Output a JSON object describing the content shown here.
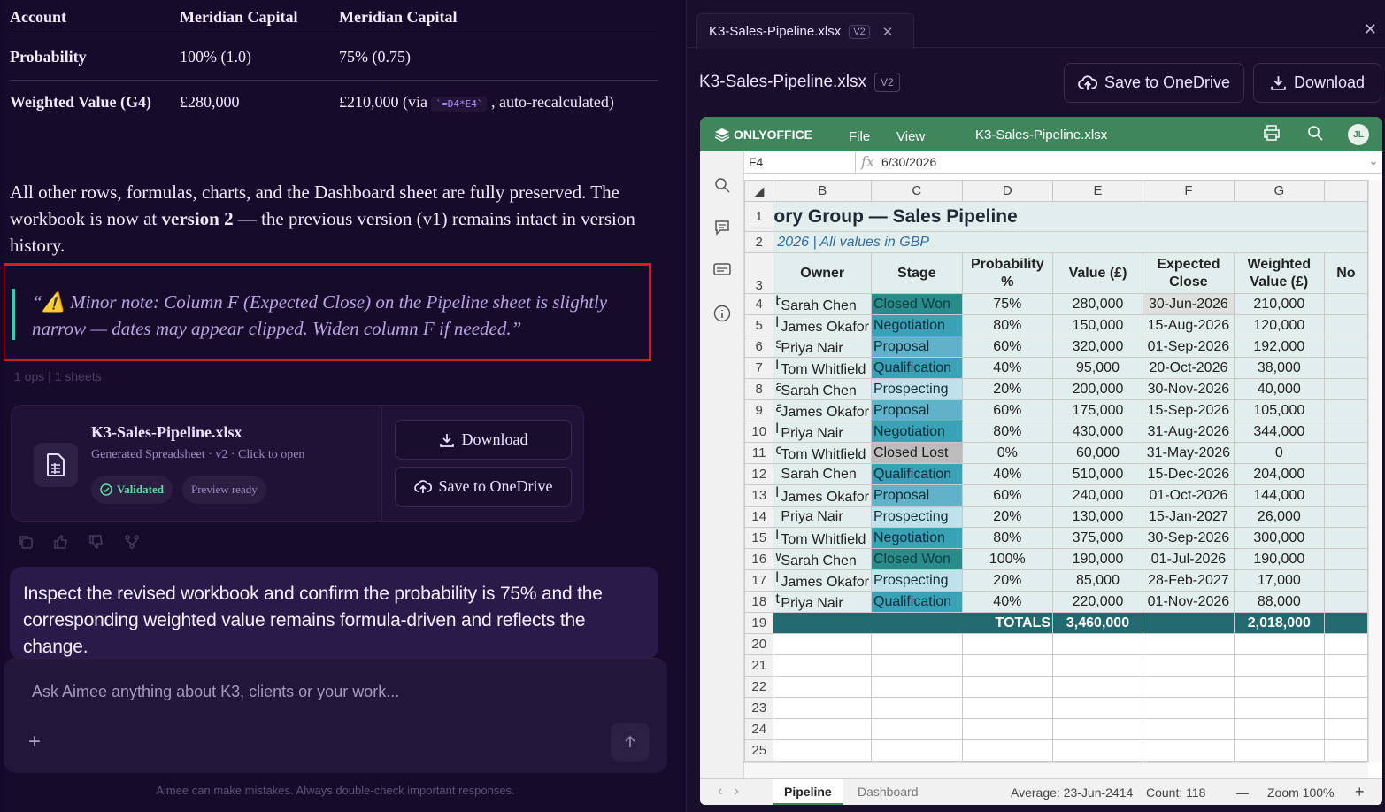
{
  "summary_table": {
    "headers": [
      "Account",
      "Meridian Capital",
      "Meridian Capital"
    ],
    "rows": [
      [
        "Probability",
        "100% (1.0)",
        "75% (0.75)"
      ],
      [
        "Weighted Value (G4)",
        "£280,000",
        "£210,000 (via",
        "`=D4*E4`",
        ", auto-recalculated)"
      ]
    ]
  },
  "paragraph": {
    "before": "All other rows, formulas, charts, and the Dashboard sheet are fully preserved. The workbook is now at ",
    "bold": "version 2",
    "after": " — the previous version (v1) remains intact in version history."
  },
  "note": "“⚠️ Minor note: Column F (Expected Close) on the Pipeline sheet is slightly narrow — dates may appear clipped. Widen column F if needed.”",
  "faint_label": "1 ops | 1 sheets",
  "file_card": {
    "name": "K3-Sales-Pipeline.xlsx",
    "subtitle": "Generated Spreadsheet · v2 · Click to open",
    "validated": "Validated",
    "preview": "Preview ready",
    "download": "Download",
    "onedrive": "Save to OneDrive"
  },
  "user_message": "Inspect the revised workbook and confirm the probability is 75% and the corresponding weighted value remains formula-driven and reflects the change.",
  "input": {
    "placeholder": "Ask Aimee anything about K3, clients or your work..."
  },
  "disclaimer": "Aimee can make mistakes. Always double-check important responses.",
  "panel": {
    "tab_name": "K3-Sales-Pipeline.xlsx",
    "version": "V2",
    "title": "K3-Sales-Pipeline.xlsx",
    "onedrive": "Save to OneDrive",
    "download": "Download"
  },
  "onlyoffice": {
    "logo": "ONLYOFFICE",
    "menu": [
      "File",
      "View"
    ],
    "doc_title": "K3-Sales-Pipeline.xlsx",
    "avatar": "JL",
    "cell_ref": "F4",
    "formula": "6/30/2026",
    "columns": [
      "B",
      "C",
      "D",
      "E",
      "F",
      "G"
    ],
    "title_text": "ory Group — Sales Pipeline",
    "subtitle_text": "2026  |  All values in GBP",
    "headers": [
      "Owner",
      "Stage",
      "Probability %",
      "Value (£)",
      "Expected Close",
      "Weighted Value (£)",
      "No"
    ],
    "rows": [
      [
        "Sarah Chen",
        "Closed Won",
        "75%",
        "280,000",
        "30-Jun-2026",
        "210,000"
      ],
      [
        "James Okafor",
        "Negotiation",
        "80%",
        "150,000",
        "15-Aug-2026",
        "120,000"
      ],
      [
        "Priya Nair",
        "Proposal",
        "60%",
        "320,000",
        "01-Sep-2026",
        "192,000"
      ],
      [
        "Tom Whitfield",
        "Qualification",
        "40%",
        "95,000",
        "20-Oct-2026",
        "38,000"
      ],
      [
        "Sarah Chen",
        "Prospecting",
        "20%",
        "200,000",
        "30-Nov-2026",
        "40,000"
      ],
      [
        "James Okafor",
        "Proposal",
        "60%",
        "175,000",
        "15-Sep-2026",
        "105,000"
      ],
      [
        "Priya Nair",
        "Negotiation",
        "80%",
        "430,000",
        "31-Aug-2026",
        "344,000"
      ],
      [
        "Tom Whitfield",
        "Closed Lost",
        "0%",
        "60,000",
        "31-May-2026",
        "0"
      ],
      [
        "Sarah Chen",
        "Qualification",
        "40%",
        "510,000",
        "15-Dec-2026",
        "204,000"
      ],
      [
        "James Okafor",
        "Proposal",
        "60%",
        "240,000",
        "01-Oct-2026",
        "144,000"
      ],
      [
        "Priya Nair",
        "Prospecting",
        "20%",
        "130,000",
        "15-Jan-2027",
        "26,000"
      ],
      [
        "Tom Whitfield",
        "Negotiation",
        "80%",
        "375,000",
        "30-Sep-2026",
        "300,000"
      ],
      [
        "Sarah Chen",
        "Closed Won",
        "100%",
        "190,000",
        "01-Jul-2026",
        "190,000"
      ],
      [
        "James Okafor",
        "Prospecting",
        "20%",
        "85,000",
        "28-Feb-2027",
        "17,000"
      ],
      [
        "Priya Nair",
        "Qualification",
        "40%",
        "220,000",
        "01-Nov-2026",
        "88,000"
      ]
    ],
    "row_prefix": [
      "b",
      "l",
      "s",
      "l",
      "a",
      "a",
      "l",
      "c",
      "",
      "l",
      "",
      "l",
      "w",
      "l",
      "t"
    ],
    "totals_label": "TOTALS",
    "total_value": "3,460,000",
    "total_weighted": "2,018,000",
    "sheets": [
      "Pipeline",
      "Dashboard"
    ],
    "status_average": "Average: 23-Jun-2414",
    "status_count": "Count: 118",
    "zoom": "Zoom 100%"
  },
  "colors": {
    "accent_green": "#40865c",
    "highlight_red": "#e0191b",
    "teal_bar": "#2fd2b5"
  }
}
